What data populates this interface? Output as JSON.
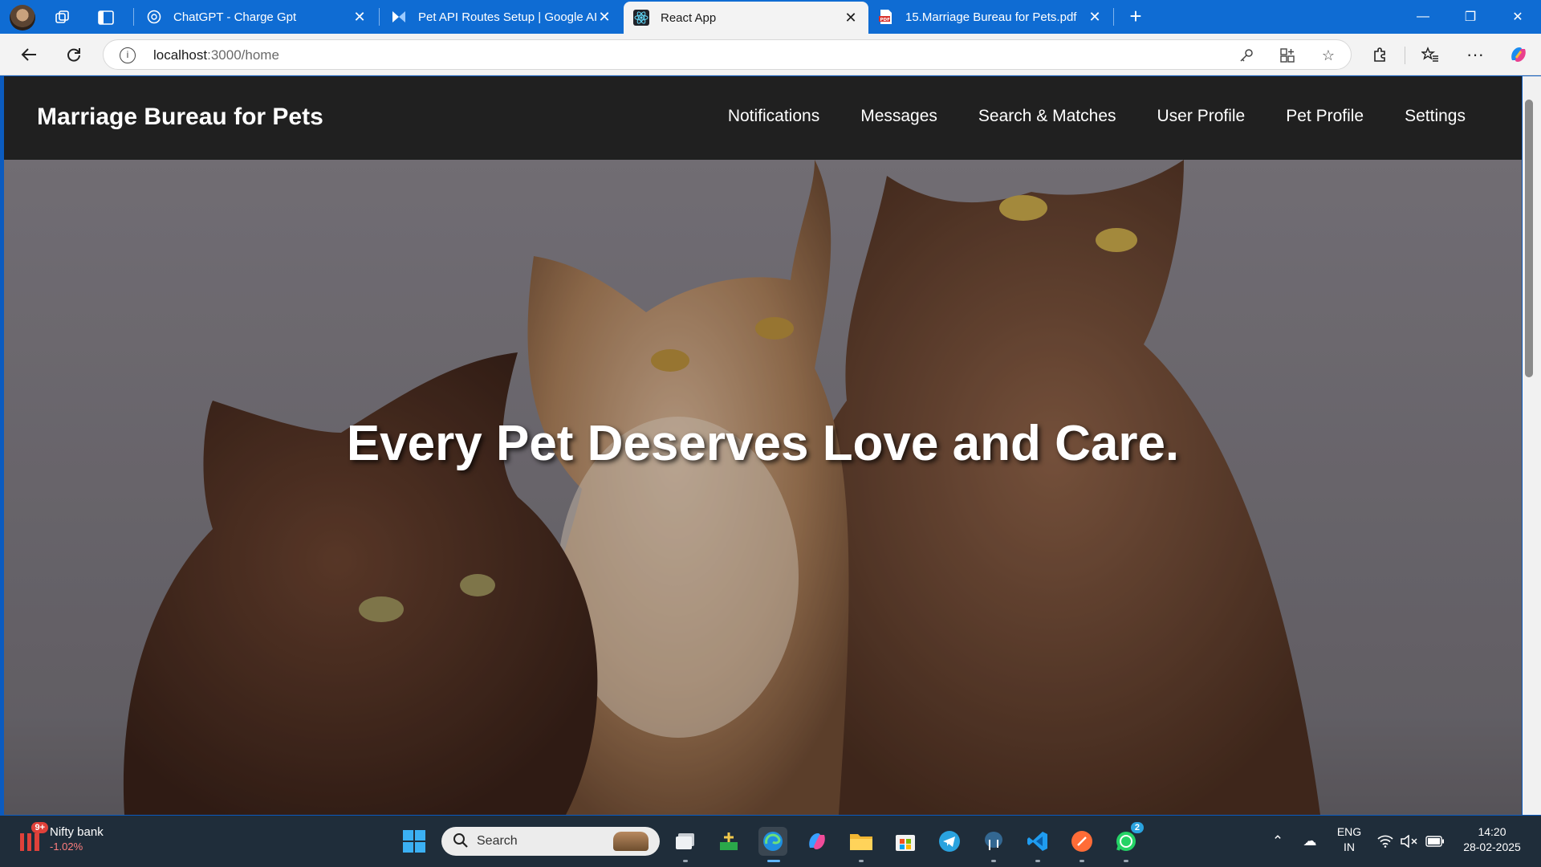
{
  "browser": {
    "tabs": [
      {
        "title": "ChatGPT - Charge Gpt",
        "favicon": "openai-icon"
      },
      {
        "title": "Pet API Routes Setup | Google AI",
        "favicon": "google-ai-studio-icon"
      },
      {
        "title": "React App",
        "favicon": "react-icon",
        "active": true
      },
      {
        "title": "15.Marriage Bureau for Pets.pdf",
        "favicon": "pdf-icon"
      }
    ],
    "url_host": "localhost",
    "url_path": ":3000/home"
  },
  "page": {
    "brand": "Marriage Bureau for Pets",
    "nav": [
      "Notifications",
      "Messages",
      "Search & Matches",
      "User Profile",
      "Pet Profile",
      "Settings"
    ],
    "hero_title": "Every Pet Deserves Love and Care.",
    "hero_image": "three-brown-kittens"
  },
  "taskbar": {
    "widget": {
      "badge": "9+",
      "name": "Nifty bank",
      "change": "-1.02%"
    },
    "search_label": "Search",
    "whatsapp_badge": "2",
    "language": "ENG",
    "region": "IN",
    "time": "14:20",
    "date": "28-02-2025"
  },
  "colors": {
    "tabstrip": "#0f6cd3",
    "navbar": "#202020",
    "taskbar": "#1f2d3a",
    "stock_negative": "#ff7e7e"
  }
}
